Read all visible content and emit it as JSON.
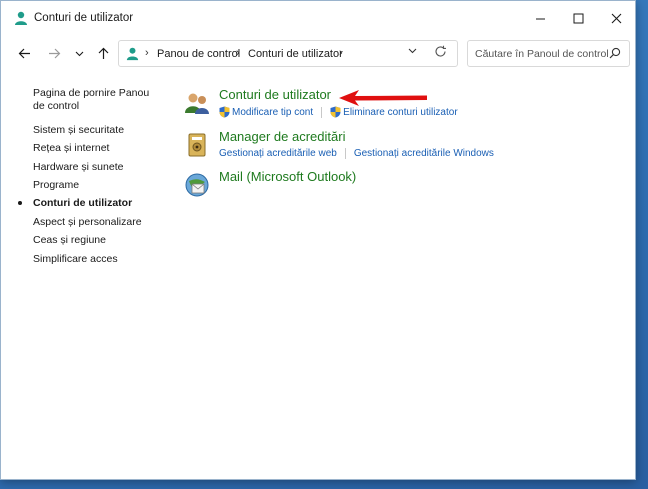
{
  "window": {
    "title": "Conturi de utilizator",
    "controls": {
      "minimize_icon": "minimize-icon",
      "maximize_icon": "maximize-icon",
      "close_icon": "close-icon"
    }
  },
  "nav": {
    "breadcrumb": [
      "Panou de control",
      "Conturi de utilizator"
    ],
    "search_placeholder": "Căutare în Panoul de control"
  },
  "sidebar": {
    "items": [
      {
        "label": "Pagina de pornire Panou de control",
        "current": false
      },
      {
        "label": "Sistem și securitate",
        "current": false
      },
      {
        "label": "Rețea și internet",
        "current": false
      },
      {
        "label": "Hardware și sunete",
        "current": false
      },
      {
        "label": "Programe",
        "current": false
      },
      {
        "label": "Conturi de utilizator",
        "current": true
      },
      {
        "label": "Aspect și personalizare",
        "current": false
      },
      {
        "label": "Ceas și regiune",
        "current": false
      },
      {
        "label": "Simplificare acces",
        "current": false
      }
    ]
  },
  "categories": [
    {
      "title": "Conturi de utilizator",
      "icon": "user-accounts-icon",
      "links": [
        {
          "label": "Modificare tip cont",
          "shield": true
        },
        {
          "label": "Eliminare conturi utilizator",
          "shield": true
        }
      ]
    },
    {
      "title": "Manager de acreditări",
      "icon": "credential-manager-icon",
      "links": [
        {
          "label": "Gestionați acreditările web",
          "shield": false
        },
        {
          "label": "Gestionați acreditările Windows",
          "shield": false
        }
      ]
    },
    {
      "title": "Mail (Microsoft Outlook)",
      "icon": "mail-icon",
      "links": []
    }
  ],
  "colors": {
    "category_title": "#1e7a1e",
    "sublink": "#1a5fb4",
    "annotation_arrow": "#e01010",
    "desktop": "#2f6fb3"
  }
}
